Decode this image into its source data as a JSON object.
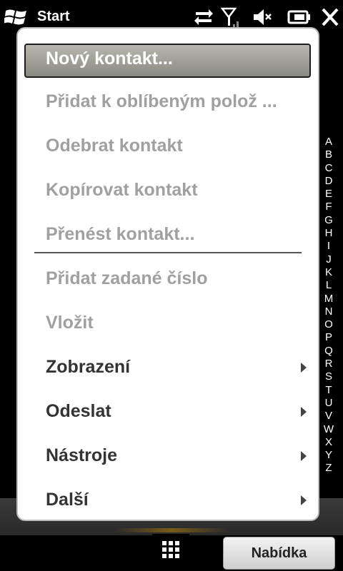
{
  "status_bar": {
    "start_label": "Start",
    "icons": [
      "windows-logo-icon",
      "sync-arrows-icon",
      "signal-antenna-icon",
      "speaker-mute-icon",
      "battery-icon",
      "close-icon"
    ]
  },
  "menu": {
    "items": [
      {
        "label": "Nový kontakt...",
        "state": "highlighted",
        "submenu": false
      },
      {
        "label": "Přidat k oblíbeným polož  ...",
        "state": "disabled",
        "submenu": false
      },
      {
        "label": "Odebrat kontakt",
        "state": "disabled",
        "submenu": false
      },
      {
        "label": "Kopírovat kontakt",
        "state": "disabled",
        "submenu": false
      },
      {
        "label": "Přenést kontakt...",
        "state": "disabled",
        "submenu": false
      },
      {
        "label": "Přidat zadané číslo",
        "state": "disabled",
        "submenu": false
      },
      {
        "label": "Vložit",
        "state": "disabled",
        "submenu": false
      },
      {
        "label": "Zobrazení",
        "state": "enabled",
        "submenu": true
      },
      {
        "label": "Odeslat",
        "state": "enabled",
        "submenu": true
      },
      {
        "label": "Nástroje",
        "state": "enabled",
        "submenu": true
      },
      {
        "label": "Další",
        "state": "enabled",
        "submenu": true
      }
    ]
  },
  "alphabet": [
    "A",
    "B",
    "C",
    "D",
    "E",
    "F",
    "G",
    "H",
    "I",
    "J",
    "K",
    "L",
    "M",
    "N",
    "O",
    "P",
    "Q",
    "R",
    "S",
    "T",
    "U",
    "V",
    "W",
    "X",
    "Y",
    "Z"
  ],
  "bottom_bar": {
    "right_softkey": "Nabídka",
    "left_icon": "app-grid-icon"
  },
  "colors": {
    "menu_background": "#ffffff",
    "disabled_text": "#a0a0a0",
    "enabled_text": "#333333",
    "highlight": "#a0a09a"
  }
}
